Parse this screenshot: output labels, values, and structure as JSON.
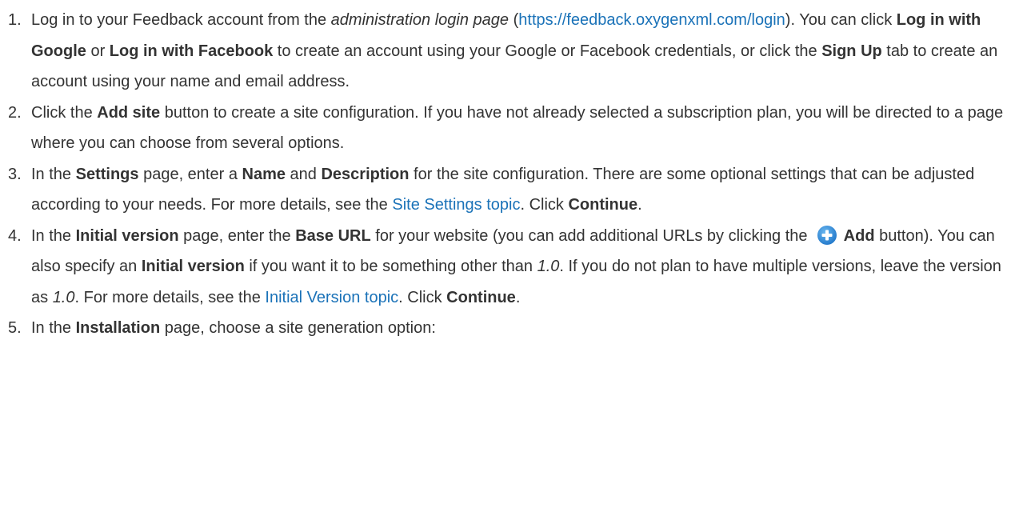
{
  "steps": [
    {
      "number": "1.",
      "segments": [
        {
          "text": "Log in to your Feedback account from the "
        },
        {
          "text": "administration login page",
          "style": "italic"
        },
        {
          "text": " ("
        },
        {
          "text": "https://feedback.oxygenxml.com/login",
          "style": "link"
        },
        {
          "text": "). You can click "
        },
        {
          "text": "Log in with Google",
          "style": "bold"
        },
        {
          "text": " or "
        },
        {
          "text": "Log in with Facebook",
          "style": "bold"
        },
        {
          "text": " to create an account using your Google or Facebook credentials, or click the "
        },
        {
          "text": "Sign Up",
          "style": "bold"
        },
        {
          "text": " tab to create an account using your name and email address."
        }
      ]
    },
    {
      "number": "2.",
      "segments": [
        {
          "text": "Click the "
        },
        {
          "text": "Add site",
          "style": "bold"
        },
        {
          "text": " button to create a site configuration. If you have not already selected a subscription plan, you will be directed to a page where you can choose from several options."
        }
      ]
    },
    {
      "number": "3.",
      "segments": [
        {
          "text": "In the "
        },
        {
          "text": "Settings",
          "style": "bold"
        },
        {
          "text": " page, enter a "
        },
        {
          "text": "Name",
          "style": "bold"
        },
        {
          "text": " and "
        },
        {
          "text": "Description",
          "style": "bold"
        },
        {
          "text": " for the site configuration. There are some optional settings that can be adjusted according to your needs. For more details, see the "
        },
        {
          "text": "Site Settings topic",
          "style": "link"
        },
        {
          "text": ". Click "
        },
        {
          "text": "Continue",
          "style": "bold"
        },
        {
          "text": "."
        }
      ]
    },
    {
      "number": "4.",
      "segments": [
        {
          "text": "In the "
        },
        {
          "text": "Initial version",
          "style": "bold"
        },
        {
          "text": " page, enter the "
        },
        {
          "text": "Base URL",
          "style": "bold"
        },
        {
          "text": " for your website (you can add additional URLs by clicking the"
        },
        {
          "icon": "add-circle-icon"
        },
        {
          "text": "Add",
          "style": "bold"
        },
        {
          "text": " button). You can also specify an "
        },
        {
          "text": "Initial version",
          "style": "bold"
        },
        {
          "text": " if you want it to be something other than "
        },
        {
          "text": "1.0",
          "style": "italic"
        },
        {
          "text": ". If you do not plan to have multiple versions, leave the version as "
        },
        {
          "text": "1.0",
          "style": "italic"
        },
        {
          "text": ". For more details, see the "
        },
        {
          "text": "Initial Version topic",
          "style": "link"
        },
        {
          "text": ". Click "
        },
        {
          "text": "Continue",
          "style": "bold"
        },
        {
          "text": "."
        }
      ]
    },
    {
      "number": "5.",
      "segments": [
        {
          "text": "In the "
        },
        {
          "text": "Installation",
          "style": "bold"
        },
        {
          "text": " page, choose a site generation option:"
        }
      ]
    }
  ],
  "colors": {
    "text": "#333333",
    "link": "#1a72b8",
    "icon": "#2f8fdc"
  }
}
